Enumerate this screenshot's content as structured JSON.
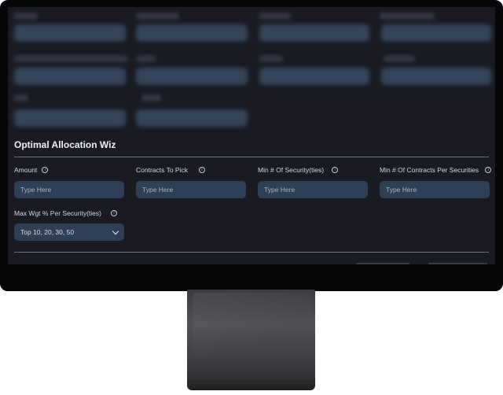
{
  "section": {
    "title": "Optimal Allocation Wiz"
  },
  "fields": {
    "amount": {
      "label": "Amount",
      "placeholder": "Type Here"
    },
    "contracts_to_pick": {
      "label": "Contracts To Pick",
      "placeholder": "Type Here"
    },
    "min_securities": {
      "label": "Min # Of Security(ties)",
      "placeholder": "Type Here"
    },
    "min_contracts_per_security": {
      "label": "Min # Of Contracts Per Securities",
      "placeholder": "Type Here"
    },
    "max_weight": {
      "label": "Max Wgt % Per Security(ties)",
      "value": "Top 10, 20, 30, 50"
    }
  },
  "icons": {
    "info": "info-icon",
    "dropdown": "chevron-down-icon"
  },
  "colors": {
    "screen_bg": "#191a22",
    "input_bg": "#2f4056",
    "bezel": "#070709"
  }
}
